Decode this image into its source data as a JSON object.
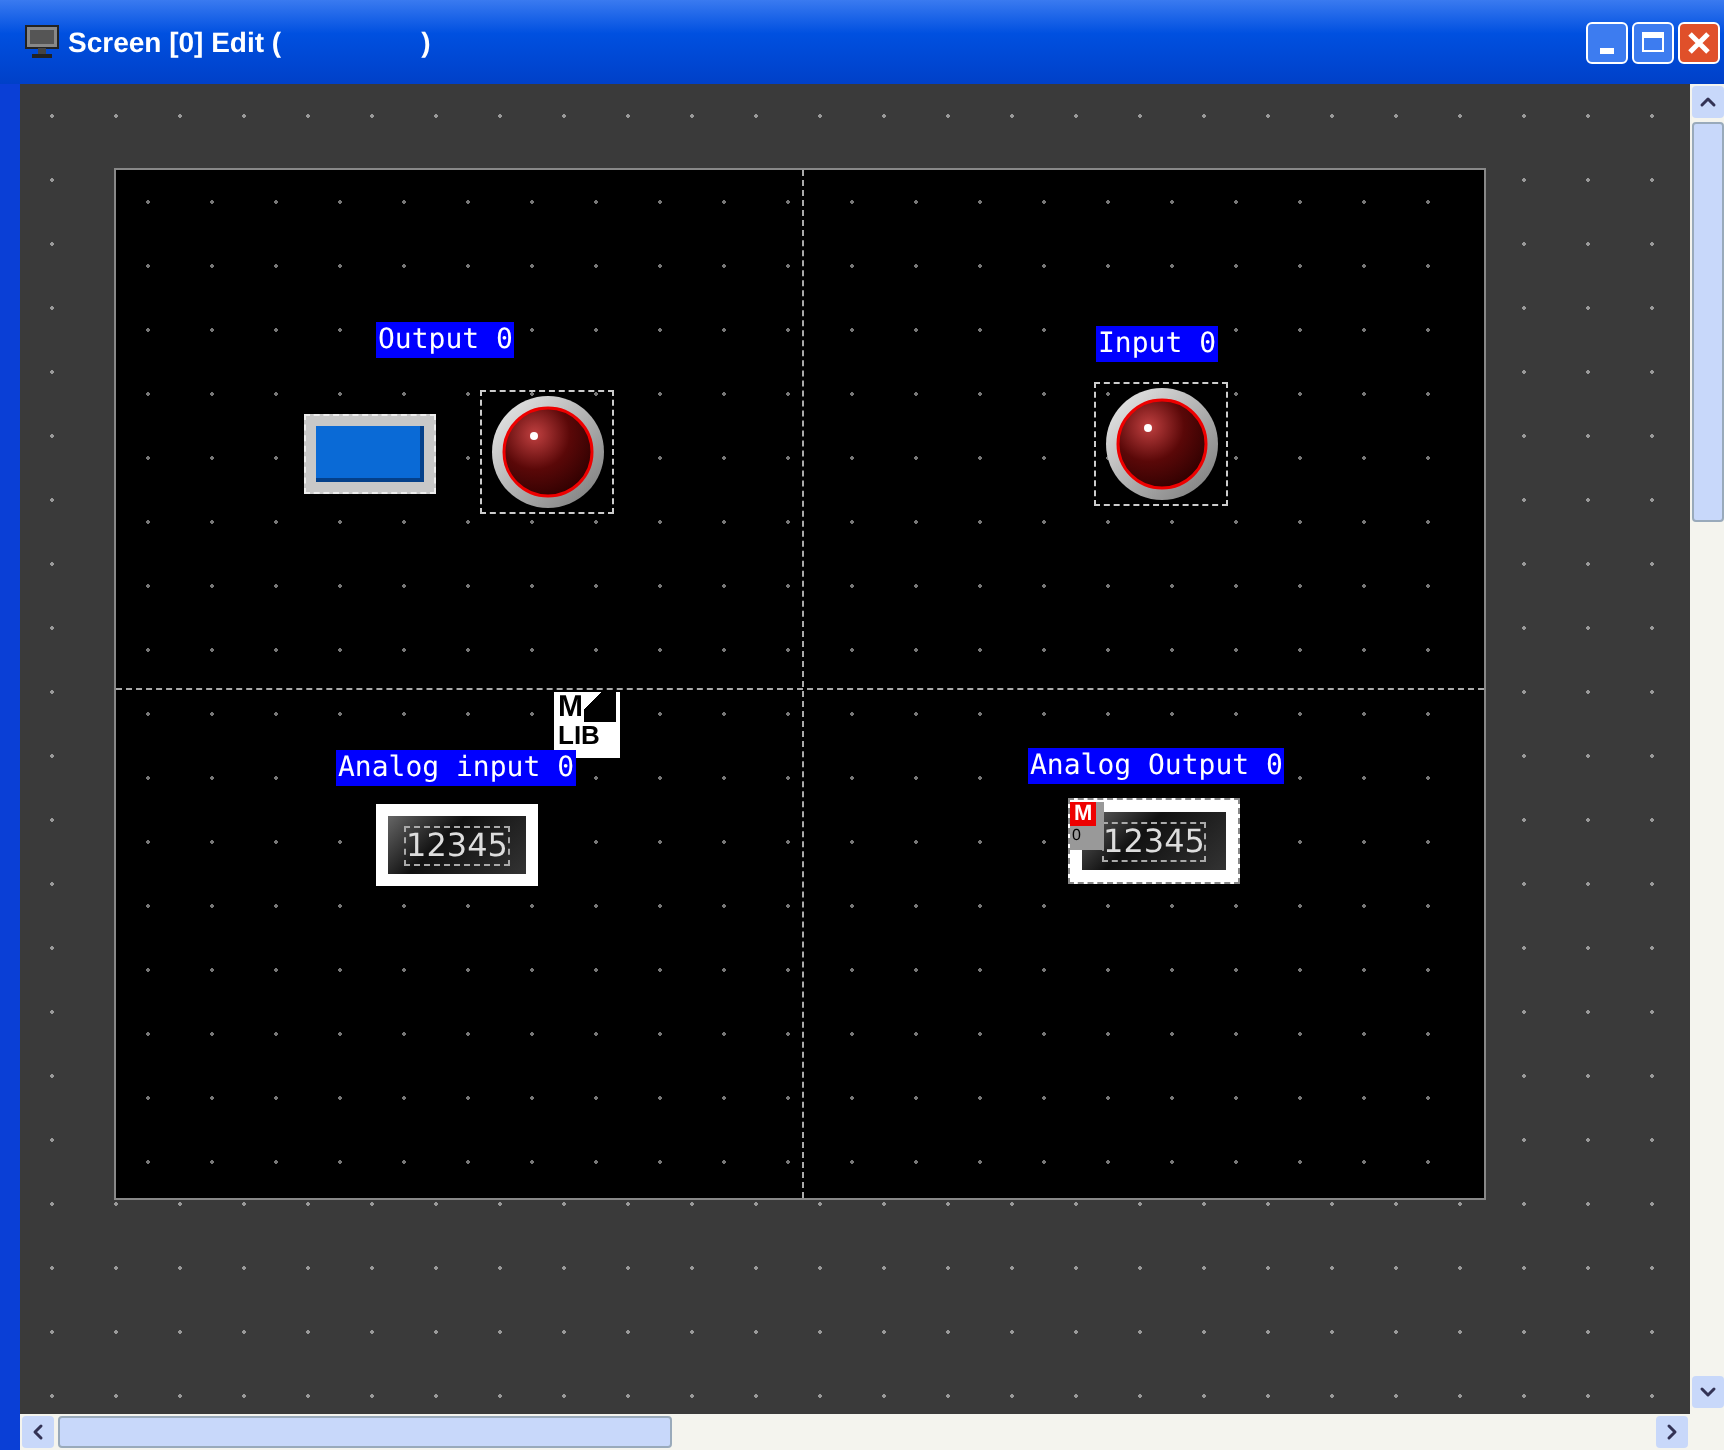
{
  "window": {
    "title": "Screen [0] Edit (",
    "title_end": ")"
  },
  "canvas": {
    "objects": [
      {
        "kind": "label",
        "text": "Output 0"
      },
      {
        "kind": "switch"
      },
      {
        "kind": "lamp"
      },
      {
        "kind": "label",
        "text": "Input 0"
      },
      {
        "kind": "lamp"
      },
      {
        "kind": "library",
        "top": "M",
        "bottom": "LIB"
      },
      {
        "kind": "label",
        "text": "Analog input 0"
      },
      {
        "kind": "numeric",
        "value": "12345"
      },
      {
        "kind": "label",
        "text": "Analog Output 0"
      },
      {
        "kind": "numeric",
        "value": "12345",
        "badge": "M",
        "badge_sub": "0"
      }
    ]
  }
}
